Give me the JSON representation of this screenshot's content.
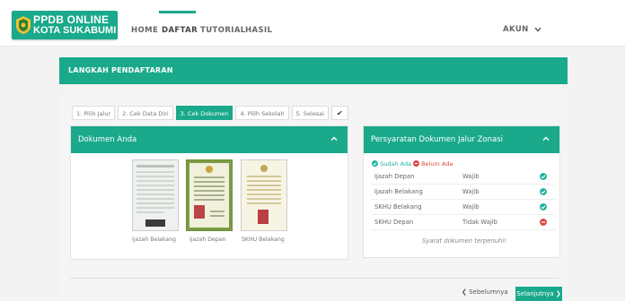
{
  "header": {
    "logo_line1": "PPDB ONLINE",
    "logo_line2": "KOTA SUKABUMI",
    "nav": [
      "HOME",
      "DAFTAR",
      "TUTORIAL",
      "HASIL"
    ],
    "active_nav": "DAFTAR",
    "account_label": "AKUN",
    "account_caret": "⌄"
  },
  "section": {
    "title": "LANGKAH PENDAFTARAN"
  },
  "steps": [
    {
      "label": "1. Pilih Jalur",
      "active": false
    },
    {
      "label": "2. Cek Data Diri",
      "active": false
    },
    {
      "label": "3. Cek Dokumen",
      "active": true
    },
    {
      "label": "4. Pilih Sekolah",
      "active": false
    },
    {
      "label": "5. Selesai",
      "active": false
    },
    {
      "label": "✔",
      "active": false
    }
  ],
  "documents_card": {
    "title": "Dokumen Anda",
    "documents": [
      {
        "caption": "Ijazah Belakang"
      },
      {
        "caption": "Ijazah Depan"
      },
      {
        "caption": "SKHU Belakang"
      }
    ]
  },
  "requirements_card": {
    "title": "Persyaratan Dokumen Jalur Zonasi",
    "legend_done": "Sudah Ada",
    "legend_missing": "Belum Ada",
    "rows": [
      {
        "name": "Ijazah Depan",
        "status": "Wajib",
        "ok": true
      },
      {
        "name": "Ijazah Belakang",
        "status": "Wajib",
        "ok": true
      },
      {
        "name": "SKHU Belakang",
        "status": "Wajib",
        "ok": true
      },
      {
        "name": "SKHU Depan",
        "status": "Tidak Wajib",
        "ok": false
      }
    ],
    "note": "Syarat dokumen terpenuhi!"
  },
  "footer": {
    "prev_label": "❮ Sebelumnya",
    "next_label": "Selanjutnya ❯"
  },
  "colors": {
    "brand": "#1aa98b",
    "ok": "#1fb3a0",
    "missing": "#e0463f"
  }
}
